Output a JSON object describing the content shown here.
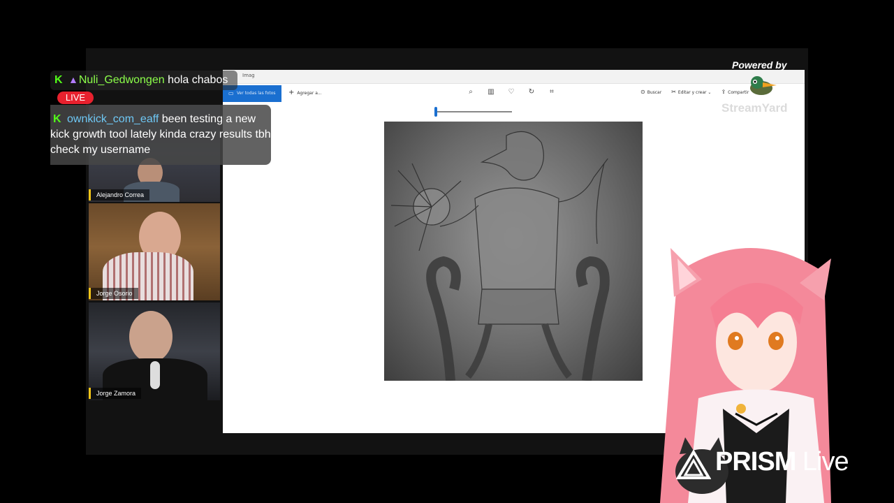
{
  "chat": {
    "messages": [
      {
        "user": "Nuli_Gedwongen",
        "text": "hola chabos"
      },
      {
        "user": "ownkick_com_eaff",
        "text": "been testing a new kick growth tool lately kinda crazy results tbh check my username"
      }
    ],
    "live_badge": "LIVE"
  },
  "participants": [
    {
      "name": "Alejandro Correa"
    },
    {
      "name": "Jorge Osorio"
    },
    {
      "name": "Jorge Zamora"
    }
  ],
  "screen_share": {
    "title": "Imag",
    "toolbar": {
      "all_photos": "Ver todas las fotos",
      "add": "Agregar a...",
      "search": "Buscar",
      "edit": "Editar y crear",
      "share": "Compartir",
      "more": "..."
    },
    "zoom_level": 0.02
  },
  "watermarks": {
    "powered_by": "Powered by",
    "streamyard": "StreamYard",
    "prism": "PRISM",
    "prism_live": "Live"
  },
  "colors": {
    "kick_green": "#53fc18",
    "live_red": "#e8212e",
    "name_label_accent": "#f5c518",
    "photos_blue": "#1a6fd0"
  }
}
